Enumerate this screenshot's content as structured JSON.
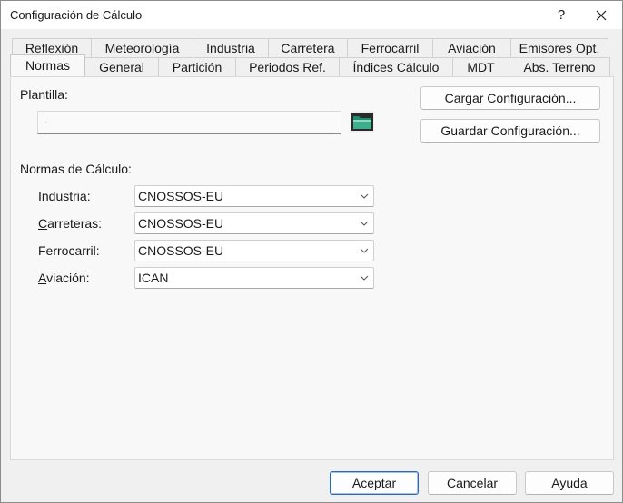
{
  "window": {
    "title": "Configuración de Cálculo",
    "help_label": "?"
  },
  "tabs_back": [
    {
      "label": "Reflexión"
    },
    {
      "label": "Meteorología"
    },
    {
      "label": "Industria"
    },
    {
      "label": "Carretera"
    },
    {
      "label": "Ferrocarril"
    },
    {
      "label": "Aviación"
    },
    {
      "label": "Emisores Opt."
    }
  ],
  "tabs_front": [
    {
      "label": "Normas",
      "active": true
    },
    {
      "label": "General"
    },
    {
      "label": "Partición"
    },
    {
      "label": "Periodos Ref."
    },
    {
      "label": "Índices Cálculo"
    },
    {
      "label": "MDT"
    },
    {
      "label": "Abs. Terreno"
    }
  ],
  "template": {
    "label": "Plantilla:",
    "value": "-",
    "browse_icon": "folder-icon"
  },
  "config_buttons": {
    "load": "Cargar Configuración...",
    "save": "Guardar Configuración..."
  },
  "norms": {
    "section_label": "Normas de Cálculo:",
    "rows": [
      {
        "label": "Industria:",
        "value": "CNOSSOS-EU"
      },
      {
        "label": "Carreteras:",
        "value": "CNOSSOS-EU"
      },
      {
        "label": "Ferrocarril:",
        "value": "CNOSSOS-EU"
      },
      {
        "label": "Aviación:",
        "value": "ICAN"
      }
    ]
  },
  "footer": {
    "ok": "Aceptar",
    "cancel": "Cancelar",
    "help": "Ayuda"
  },
  "colors": {
    "accent": "#2b6ab8",
    "folder": "#1e8a6e"
  }
}
